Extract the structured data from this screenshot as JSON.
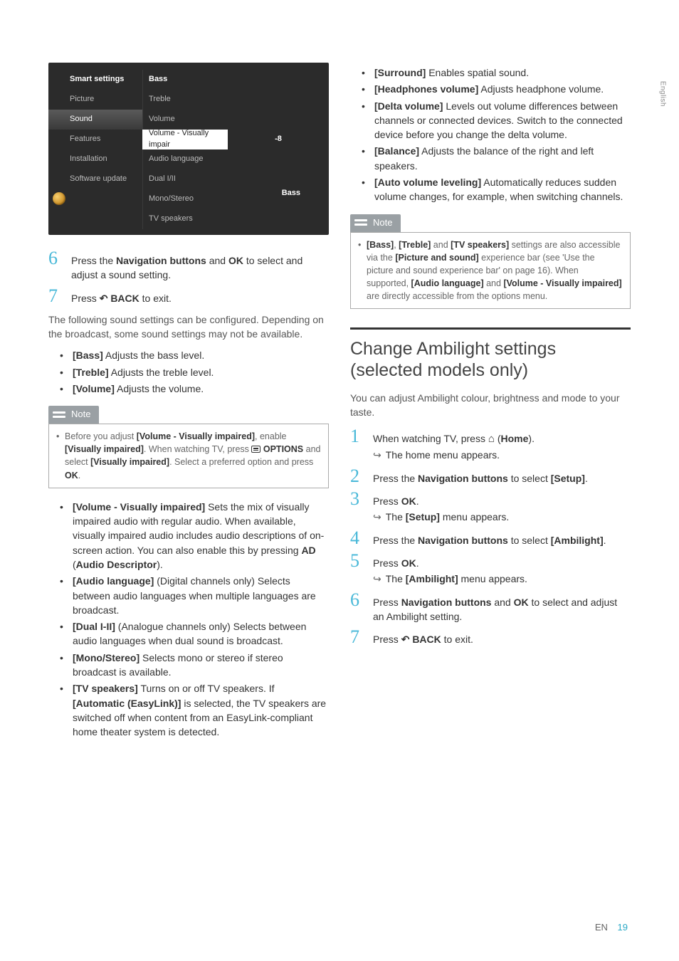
{
  "side_tab": "English",
  "footer": {
    "lang": "EN",
    "page": "19"
  },
  "tv_menu": {
    "left": [
      "Smart settings",
      "Picture",
      "Sound",
      "Features",
      "Installation",
      "Software update"
    ],
    "right": [
      "Bass",
      "Treble",
      "Volume",
      "Volume - Visually impair",
      "Audio language",
      "Dual I/II",
      "Mono/Stereo",
      "TV speakers"
    ],
    "value": "-8",
    "preview_label": "Bass"
  },
  "left_col": {
    "step6": {
      "pre": "Press the ",
      "b1": "Navigation buttons",
      "mid": " and ",
      "b2": "OK",
      "post": " to select and adjust a sound setting."
    },
    "step7": {
      "pre": "Press ",
      "b": "BACK",
      "post": " to exit."
    },
    "intro": "The following sound settings can be configured. Depending on the broadcast, some sound settings may not be available.",
    "bullets1": [
      {
        "b": "[Bass]",
        "t": " Adjusts the bass level."
      },
      {
        "b": "[Treble]",
        "t": " Adjusts the treble level."
      },
      {
        "b": "[Volume]",
        "t": " Adjusts the volume."
      }
    ],
    "note_label": "Note",
    "note1": {
      "pre": "Before you adjust ",
      "b1": "[Volume - Visually impaired]",
      "mid1": ", enable ",
      "b2": "[Visually impaired]",
      "mid2": ". When watching TV, press ",
      "b3": "OPTIONS",
      "mid3": " and select ",
      "b4": "[Visually impaired]",
      "mid4": ". Select a preferred option and press ",
      "b5": "OK",
      "post": "."
    },
    "bullets2": [
      {
        "b": "[Volume - Visually impaired]",
        "t": " Sets the mix of visually impaired audio with regular audio. When available, visually impaired audio includes audio descriptions of on-screen action. You can also enable this by pressing ",
        "b2": "AD",
        "mid": " (",
        "b3": "Audio Descriptor",
        "post": ")."
      },
      {
        "b": "[Audio language]",
        "t": " (Digital channels only) Selects between audio languages when multiple languages are broadcast."
      },
      {
        "b": "[Dual I-II]",
        "t": " (Analogue channels only) Selects between audio languages when dual sound is broadcast."
      },
      {
        "b": "[Mono/Stereo]",
        "t": " Selects mono or stereo if stereo broadcast is available."
      },
      {
        "b": "[TV speakers]",
        "t": " Turns on or off TV speakers. If ",
        "b2": "[Automatic (EasyLink)]",
        "post": " is selected, the TV speakers are switched off when content from an EasyLink-compliant home theater system is detected."
      }
    ]
  },
  "right_col": {
    "bullets1": [
      {
        "b": "[Surround]",
        "t": " Enables spatial sound."
      },
      {
        "b": "[Headphones volume]",
        "t": " Adjusts headphone volume."
      },
      {
        "b": "[Delta volume]",
        "t": " Levels out volume differences between channels or connected devices. Switch to the connected device before you change the delta volume."
      },
      {
        "b": "[Balance]",
        "t": " Adjusts the balance of the right and left speakers."
      },
      {
        "b": "[Auto volume leveling]",
        "t": " Automatically reduces sudden volume changes, for example, when switching channels."
      }
    ],
    "note_label": "Note",
    "note2": {
      "b1": "[Bass]",
      "s1": ", ",
      "b2": "[Treble]",
      "s2": " and ",
      "b3": "[TV speakers]",
      "s3": " settings are also accessible via the ",
      "b4": "[Picture and sound]",
      "s4": " experience bar (see 'Use the picture and sound experience bar' on page 16). When supported, ",
      "b5": "[Audio language]",
      "s5": " and ",
      "b6": "[Volume - Visually impaired]",
      "s6": " are directly accessible from the options menu."
    },
    "heading": "Change Ambilight settings (selected models only)",
    "intro": "You can adjust Ambilight colour, brightness and mode to your taste.",
    "step1": {
      "pre": "When watching TV, press ",
      "post1": " (",
      "b2": "Home",
      "post2": ").",
      "result": "The home menu appears."
    },
    "step2": {
      "pre": "Press the ",
      "b1": "Navigation buttons",
      "mid": " to select ",
      "b2": "[Setup]",
      "post": "."
    },
    "step3": {
      "pre": "Press ",
      "b1": "OK",
      "post": ".",
      "result_pre": "The ",
      "result_b": "[Setup]",
      "result_post": " menu appears."
    },
    "step4": {
      "pre": "Press the ",
      "b1": "Navigation buttons",
      "mid": " to select ",
      "b2": "[Ambilight]",
      "post": "."
    },
    "step5": {
      "pre": "Press ",
      "b1": "OK",
      "post": ".",
      "result_pre": "The ",
      "result_b": "[Ambilight]",
      "result_post": " menu appears."
    },
    "step6": {
      "pre": "Press ",
      "b1": "Navigation buttons",
      "mid": " and ",
      "b2": "OK",
      "post": " to select and adjust an Ambilight setting."
    },
    "step7": {
      "pre": "Press ",
      "b1": "BACK",
      "post": " to exit."
    }
  }
}
